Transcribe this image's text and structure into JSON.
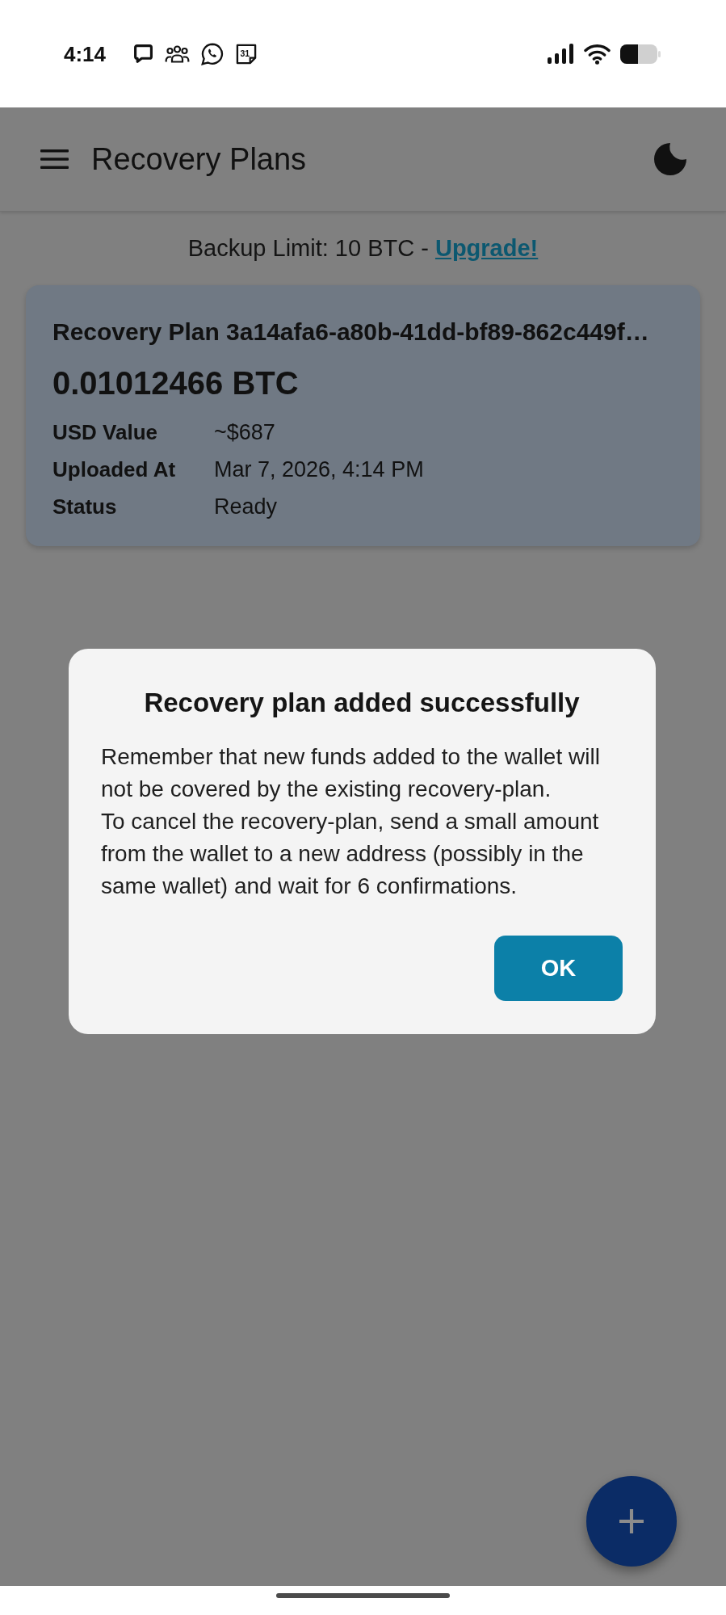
{
  "status_bar": {
    "time": "4:14",
    "calendar_day": "31"
  },
  "app_bar": {
    "title": "Recovery Plans"
  },
  "backup_limit": {
    "text": "Backup Limit: 10 BTC -",
    "link": "Upgrade!"
  },
  "plans": [
    {
      "title": "Recovery Plan 3a14afa6-a80b-41dd-bf89-862c449f…",
      "amount": "0.01012466 BTC",
      "fields": [
        {
          "label": "USD Value",
          "value": "~$687"
        },
        {
          "label": "Uploaded At",
          "value": "Mar 7, 2026, 4:14 PM"
        },
        {
          "label": "Status",
          "value": "Ready"
        }
      ]
    }
  ],
  "dialog": {
    "title": "Recovery plan added successfully",
    "paragraphs": [
      "Remember that new funds added to the wallet will not be covered by the existing recovery-plan.",
      "To cancel the recovery-plan, send a small amount from the wallet to a new address (possibly in the same wallet) and wait for 6 confirmations."
    ],
    "buttons": [
      "OK"
    ]
  }
}
